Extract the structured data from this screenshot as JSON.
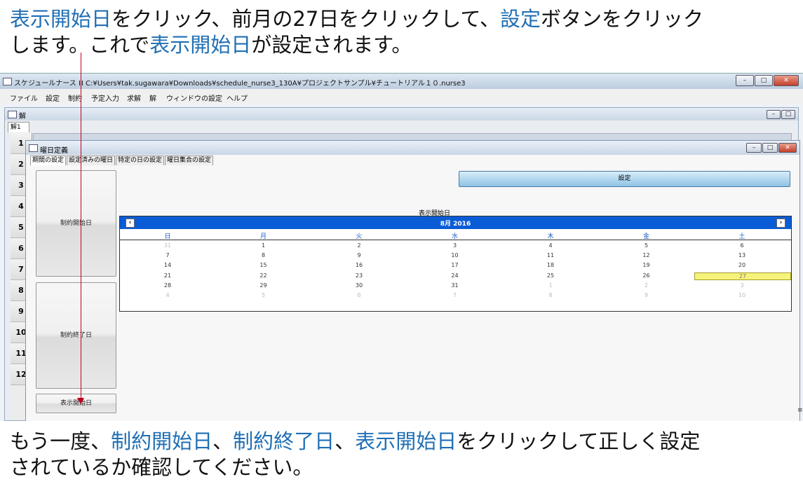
{
  "caption_top": {
    "line1": [
      {
        "text": "表示開始日",
        "hl": true
      },
      {
        "text": "をクリック、前月の27日をクリックして、",
        "hl": false
      },
      {
        "text": "設定",
        "hl": true
      },
      {
        "text": "ボタンをクリック",
        "hl": false
      }
    ],
    "line2": [
      {
        "text": "します。これで",
        "hl": false
      },
      {
        "text": "表示開始日",
        "hl": true
      },
      {
        "text": "が設定されます。",
        "hl": false
      }
    ]
  },
  "caption_bottom": {
    "line1": [
      {
        "text": "もう一度、",
        "hl": false
      },
      {
        "text": "制約開始日",
        "hl": true
      },
      {
        "text": "、",
        "hl": false
      },
      {
        "text": "制約終了日",
        "hl": true
      },
      {
        "text": "、",
        "hl": false
      },
      {
        "text": "表示開始日",
        "hl": true
      },
      {
        "text": "をクリックして正しく設定",
        "hl": false
      }
    ],
    "line2": [
      {
        "text": "されているか確認してください。",
        "hl": false
      }
    ]
  },
  "app": {
    "title": "スケジュールナース Ⅲ  C:¥Users¥tak.sugawara¥Downloads¥schedule_nurse3_130A¥プロジェクトサンプル¥チュートリアル１０.nurse3",
    "menu": [
      "ファイル",
      "設定",
      "制約",
      "予定入力",
      "求解",
      "解",
      "ウィンドウの設定",
      "ヘルプ"
    ],
    "child_title": "解",
    "child_tab": "解1",
    "row_headers": [
      "1",
      "2",
      "3",
      "4",
      "5",
      "6",
      "7",
      "8",
      "9",
      "10",
      "11",
      "12"
    ],
    "right_marker": "≡"
  },
  "dialog": {
    "title": "曜日定義",
    "tabs": [
      "期間の設定",
      "設定済みの曜日",
      "特定の日の設定",
      "曜日集合の設定"
    ],
    "btn_constraint_start": "制約開始日",
    "btn_constraint_end": "制約終了日",
    "btn_display_start": "表示開始日",
    "btn_set": "設定",
    "calendar_label": "表示開始日",
    "calendar": {
      "month": "8月 2016",
      "prev": "‹",
      "next": "›",
      "dow": [
        "日",
        "月",
        "火",
        "水",
        "木",
        "金",
        "土"
      ],
      "weeks": [
        [
          "31",
          "1",
          "2",
          "3",
          "4",
          "5",
          "6"
        ],
        [
          "7",
          "8",
          "9",
          "10",
          "11",
          "12",
          "13"
        ],
        [
          "14",
          "15",
          "16",
          "17",
          "18",
          "19",
          "20"
        ],
        [
          "21",
          "22",
          "23",
          "24",
          "25",
          "26",
          "27"
        ],
        [
          "28",
          "29",
          "30",
          "31",
          "1",
          "2",
          "3"
        ],
        [
          "4",
          "5",
          "6",
          "7",
          "8",
          "9",
          "10"
        ]
      ],
      "dim_flags": [
        [
          true,
          false,
          false,
          false,
          false,
          false,
          false
        ],
        [
          false,
          false,
          false,
          false,
          false,
          false,
          false
        ],
        [
          false,
          false,
          false,
          false,
          false,
          false,
          false
        ],
        [
          false,
          false,
          false,
          false,
          false,
          false,
          false
        ],
        [
          false,
          false,
          false,
          false,
          true,
          true,
          true
        ],
        [
          true,
          true,
          true,
          true,
          true,
          true,
          true
        ]
      ],
      "selected": "27"
    }
  }
}
